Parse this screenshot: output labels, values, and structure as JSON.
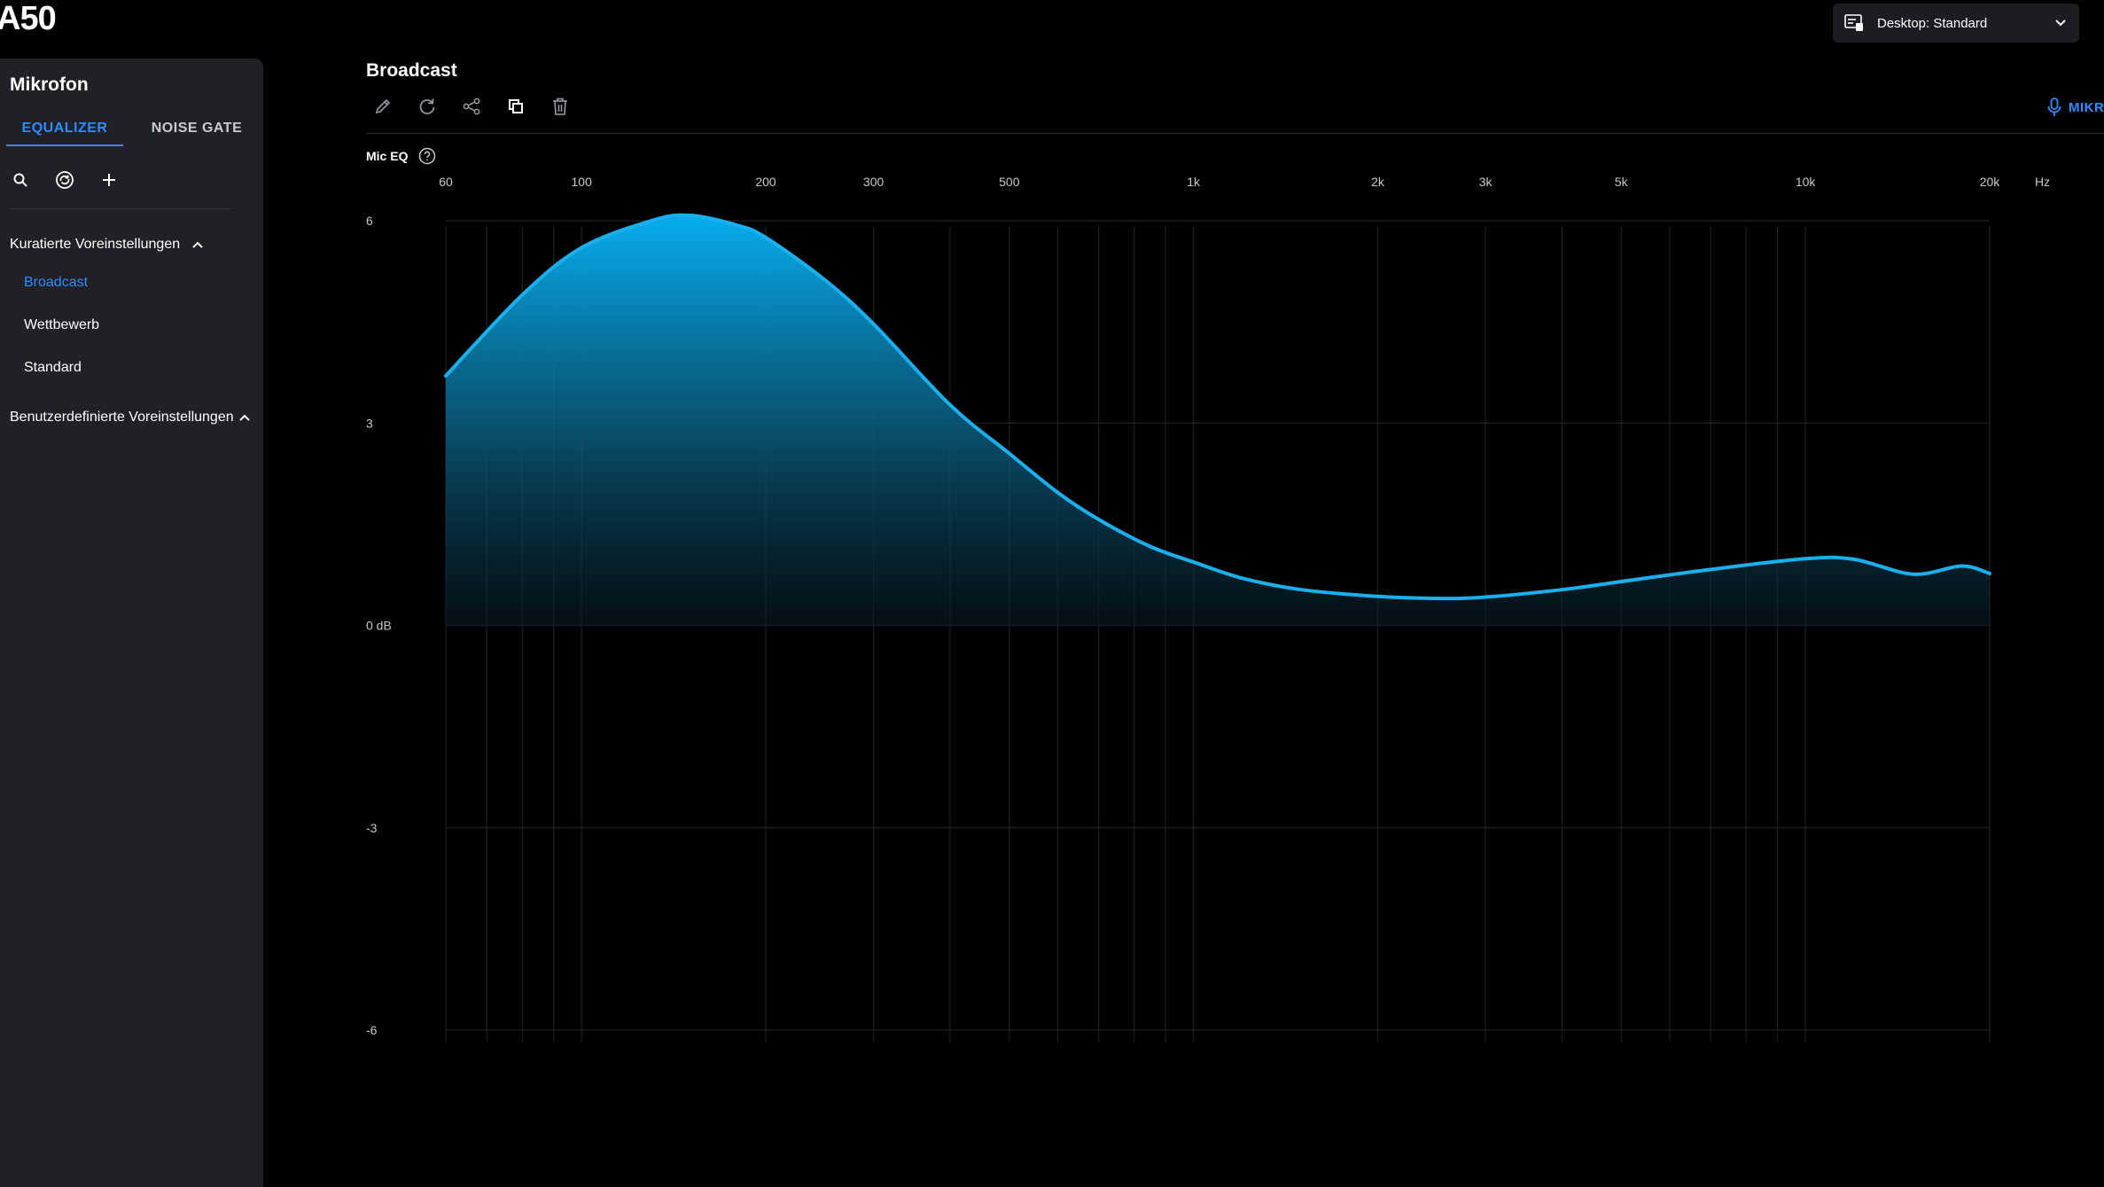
{
  "app": {
    "logo": "A50"
  },
  "device_selector": {
    "label": "Desktop: Standard"
  },
  "sidebar": {
    "title": "Mikrofon",
    "tabs": [
      {
        "label": "EQUALIZER",
        "active": true
      },
      {
        "label": "NOISE GATE",
        "active": false
      }
    ],
    "tools": [
      "search-icon",
      "sync-icon",
      "plus-icon"
    ],
    "sections": [
      {
        "label": "Kuratierte Voreinstellungen",
        "expanded": true,
        "items": [
          {
            "label": "Broadcast",
            "active": true
          },
          {
            "label": "Wettbewerb",
            "active": false
          },
          {
            "label": "Standard",
            "active": false
          }
        ]
      },
      {
        "label": "Benutzerdefinierte Voreinstellungen",
        "expanded": true,
        "items": []
      }
    ]
  },
  "main": {
    "preset_title": "Broadcast",
    "toolbar": [
      "edit-icon",
      "reset-icon",
      "share-icon",
      "copy-icon",
      "delete-icon"
    ],
    "mic_tab": "MIKR",
    "eq_label": "Mic EQ",
    "unit_label": "Hz"
  },
  "colors": {
    "accent": "#2d8cff",
    "curve": "#1ab0f0",
    "panel": "#202126",
    "background": "#000000"
  },
  "chart_data": {
    "type": "area",
    "x_scale": "log",
    "xlim": [
      60,
      20000
    ],
    "ylim": [
      -6,
      6
    ],
    "x_ticks": [
      {
        "value": 60,
        "label": "60"
      },
      {
        "value": 100,
        "label": "100"
      },
      {
        "value": 200,
        "label": "200"
      },
      {
        "value": 300,
        "label": "300"
      },
      {
        "value": 500,
        "label": "500"
      },
      {
        "value": 1000,
        "label": "1k"
      },
      {
        "value": 2000,
        "label": "2k"
      },
      {
        "value": 3000,
        "label": "3k"
      },
      {
        "value": 5000,
        "label": "5k"
      },
      {
        "value": 10000,
        "label": "10k"
      },
      {
        "value": 20000,
        "label": "20k"
      }
    ],
    "y_ticks": [
      {
        "value": 6,
        "label": "6"
      },
      {
        "value": 3,
        "label": "3"
      },
      {
        "value": 0,
        "label": "0 dB"
      },
      {
        "value": -3,
        "label": "-3"
      },
      {
        "value": -6,
        "label": "-6"
      }
    ],
    "grid": true,
    "x": [
      60,
      80,
      100,
      130,
      150,
      180,
      200,
      250,
      300,
      400,
      500,
      600,
      700,
      850,
      1000,
      1200,
      1500,
      2000,
      2500,
      3000,
      4000,
      5000,
      7000,
      10000,
      12000,
      15000,
      18000,
      20000
    ],
    "y": [
      3.7,
      4.9,
      5.6,
      6.0,
      6.08,
      5.93,
      5.75,
      5.12,
      4.47,
      3.27,
      2.55,
      1.97,
      1.57,
      1.17,
      0.94,
      0.7,
      0.53,
      0.43,
      0.4,
      0.42,
      0.53,
      0.65,
      0.83,
      0.99,
      0.98,
      0.76,
      0.88,
      0.77
    ]
  }
}
